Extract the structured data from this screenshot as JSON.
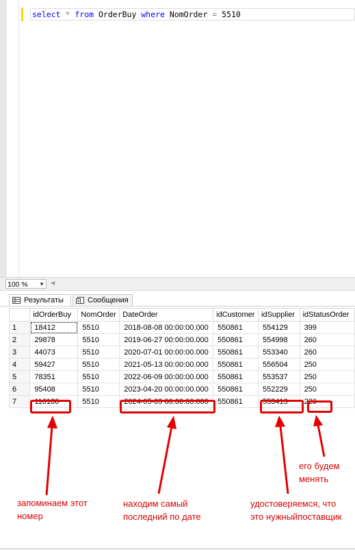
{
  "editor": {
    "query_tokens": {
      "select": "select",
      "star": "*",
      "from": "from",
      "table": "OrderBuy",
      "where": "where",
      "column": "NomOrder",
      "eq": "=",
      "value": "5510"
    }
  },
  "statusbar": {
    "zoom": "100 %"
  },
  "tabs": [
    {
      "label": "Результаты",
      "icon": "grid-icon",
      "active": true
    },
    {
      "label": "Сообщения",
      "icon": "messages-icon",
      "active": false
    }
  ],
  "grid": {
    "columns": [
      "idOrderBuy",
      "NomOrder",
      "DateOrder",
      "idCustomer",
      "idSupplier",
      "idStatusOrder"
    ],
    "rows": [
      {
        "n": "1",
        "id": "18412",
        "nom": "5510",
        "date": "2018-08-08 00:00:00.000",
        "cust": "550861",
        "sup": "554129",
        "st": "399"
      },
      {
        "n": "2",
        "id": "29878",
        "nom": "5510",
        "date": "2019-06-27 00:00:00.000",
        "cust": "550861",
        "sup": "554998",
        "st": "260"
      },
      {
        "n": "3",
        "id": "44073",
        "nom": "5510",
        "date": "2020-07-01 00:00:00.000",
        "cust": "550861",
        "sup": "553340",
        "st": "260"
      },
      {
        "n": "4",
        "id": "59427",
        "nom": "5510",
        "date": "2021-05-13 00:00:00.000",
        "cust": "550861",
        "sup": "556504",
        "st": "250"
      },
      {
        "n": "5",
        "id": "78351",
        "nom": "5510",
        "date": "2022-06-09 00:00:00.000",
        "cust": "550861",
        "sup": "553537",
        "st": "250"
      },
      {
        "n": "6",
        "id": "95408",
        "nom": "5510",
        "date": "2023-04-20 00:00:00.000",
        "cust": "550861",
        "sup": "552229",
        "st": "250"
      },
      {
        "n": "7",
        "id": "116180",
        "nom": "5510",
        "date": "2024-05-09 00:00:00.000",
        "cust": "550861",
        "sup": "553413",
        "st": "220"
      }
    ]
  },
  "annotations": {
    "color": "#e30000",
    "note1": [
      "запоминаем этот",
      "номер"
    ],
    "note2": [
      "находим самый",
      "последний по дате"
    ],
    "note3": [
      "удостоверяемся, что",
      "это нужныйпоставщик"
    ],
    "note4": [
      "его будем",
      "менять"
    ]
  }
}
